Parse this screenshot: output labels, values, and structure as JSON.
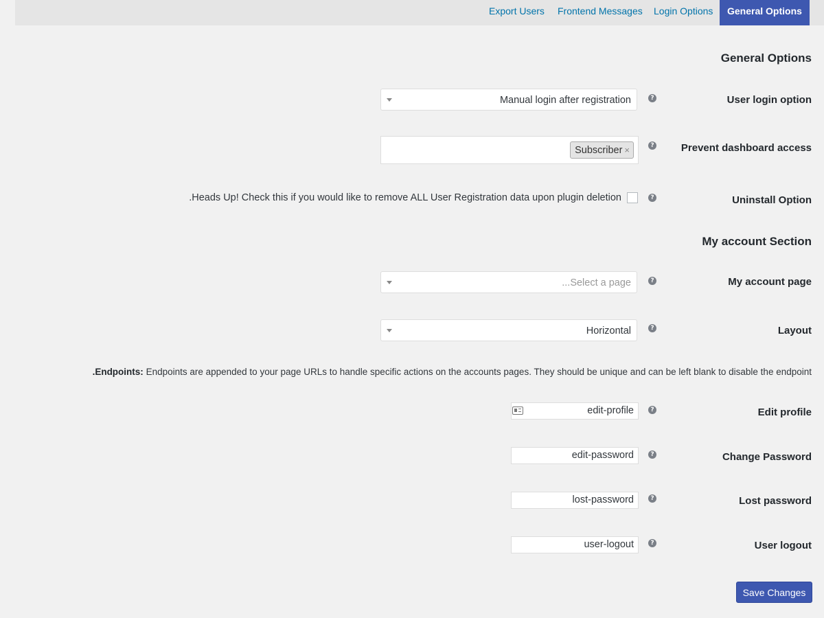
{
  "tabs": [
    {
      "label": "Export Users"
    },
    {
      "label": "Frontend Messages"
    },
    {
      "label": "Login Options"
    },
    {
      "label": "General Options",
      "active": true
    }
  ],
  "general": {
    "title": "General Options",
    "user_login_option": {
      "label": "User login option",
      "value": "Manual login after registration"
    },
    "prevent_dashboard": {
      "label": "Prevent dashboard access",
      "selected_chip": "Subscriber",
      "chip_remove": "×"
    },
    "uninstall": {
      "label": "Uninstall Option",
      "description": ".Heads Up! Check this if you would like to remove ALL User Registration data upon plugin deletion",
      "checked": false
    }
  },
  "my_account": {
    "title": "My account Section",
    "page": {
      "label": "My account page",
      "placeholder": "...Select a page"
    },
    "layout": {
      "label": "Layout",
      "value": "Horizontal"
    }
  },
  "endpoints": {
    "note_bold": ".Endpoints:",
    "note_text": " Endpoints are appended to your page URLs to handle specific actions on the accounts pages. They should be unique and can be left blank to disable the endpoint",
    "edit_profile": {
      "label": "Edit profile",
      "value": "edit-profile"
    },
    "change_password": {
      "label": "Change Password",
      "value": "edit-password"
    },
    "lost_password": {
      "label": "Lost password",
      "value": "lost-password"
    },
    "user_logout": {
      "label": "User logout",
      "value": "user-logout"
    }
  },
  "help_glyph": "?",
  "save_label": "Save Changes",
  "colors": {
    "accent": "#3e58b0",
    "link": "#0073aa",
    "background": "#f1f1f1"
  }
}
